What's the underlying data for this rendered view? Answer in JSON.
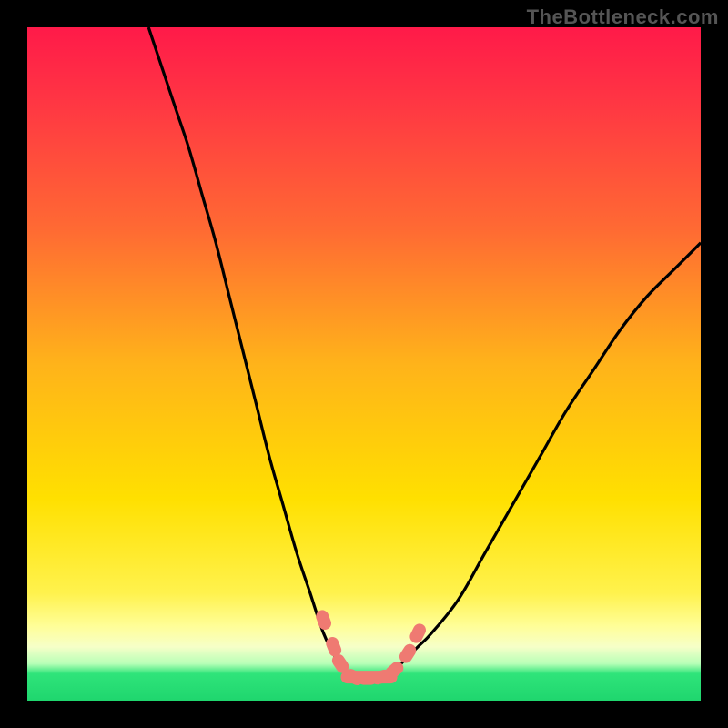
{
  "watermark": "TheBottleneck.com",
  "colors": {
    "background": "#000000",
    "gradient_top": "#ff1a49",
    "gradient_mid": "#ffe000",
    "gradient_bottom": "#1fd66e",
    "curve": "#000000",
    "marker": "#ef7a72"
  },
  "chart_data": {
    "type": "line",
    "title": "",
    "xlabel": "",
    "ylabel": "",
    "xlim": [
      0,
      100
    ],
    "ylim": [
      0,
      100
    ],
    "left_curve": {
      "x": [
        18,
        20,
        22,
        24,
        26,
        28,
        30,
        32,
        34,
        36,
        38,
        40,
        42,
        44,
        46,
        47.5
      ],
      "y": [
        100,
        94,
        88,
        82,
        75,
        68,
        60,
        52,
        44,
        36,
        29,
        22,
        16,
        10,
        6,
        4
      ]
    },
    "right_curve": {
      "x": [
        54,
        56,
        58,
        60,
        64,
        68,
        72,
        76,
        80,
        84,
        88,
        92,
        96,
        100
      ],
      "y": [
        4,
        6,
        8,
        10,
        15,
        22,
        29,
        36,
        43,
        49,
        55,
        60,
        64,
        68
      ]
    },
    "flat_segment": {
      "x": [
        47.5,
        54
      ],
      "y": [
        3.5,
        3.5
      ]
    },
    "markers": [
      {
        "x": 44.0,
        "y": 12.0
      },
      {
        "x": 45.5,
        "y": 8.0
      },
      {
        "x": 46.5,
        "y": 5.5
      },
      {
        "x": 48.5,
        "y": 3.5
      },
      {
        "x": 50.5,
        "y": 3.3
      },
      {
        "x": 52.5,
        "y": 3.5
      },
      {
        "x": 54.5,
        "y": 4.5
      },
      {
        "x": 56.5,
        "y": 7.0
      },
      {
        "x": 58.0,
        "y": 10.0
      }
    ]
  }
}
